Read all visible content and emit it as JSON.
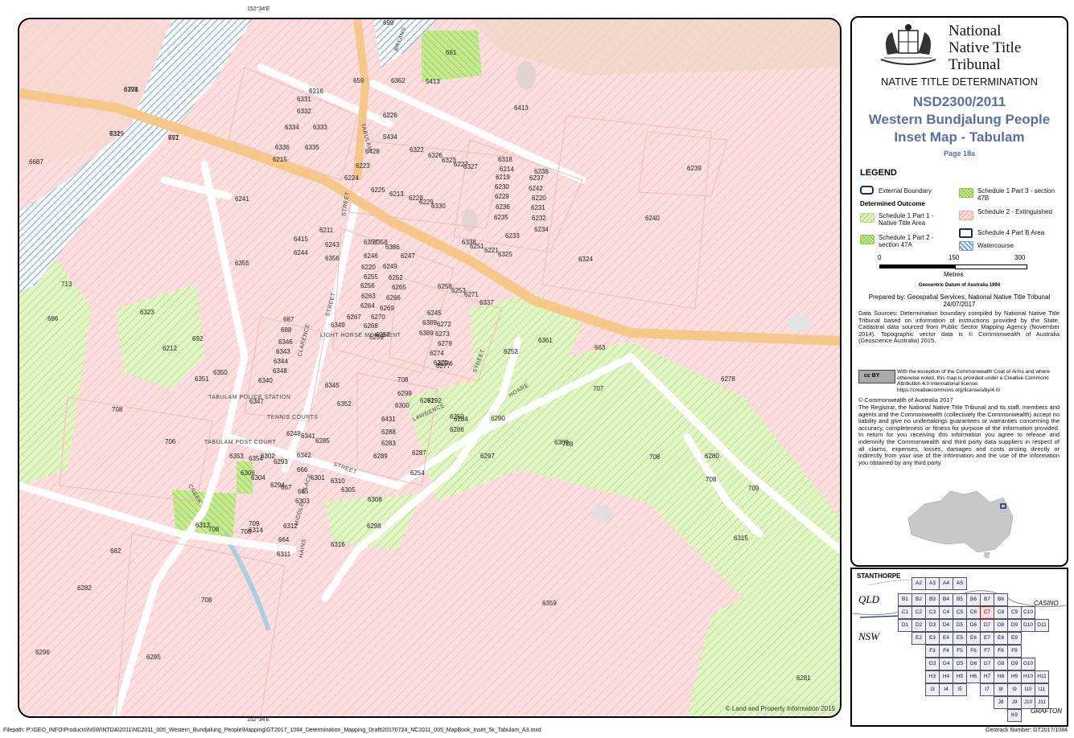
{
  "map": {
    "coord_top": "152°34'E",
    "coord_bottom": "152°34'E",
    "copyright": "© Land and Property Information 2015",
    "parcels": [
      "6778",
      "732",
      "757",
      "6687",
      "713",
      "686",
      "6216",
      "6331",
      "6332",
      "6334",
      "6333",
      "6336",
      "6335",
      "6215",
      "659",
      "6362",
      "699",
      "661",
      "5413",
      "6413",
      "6226",
      "5434",
      "6322",
      "6326",
      "6323",
      "6227",
      "6327",
      "6428",
      "6223",
      "6224",
      "6225",
      "6213",
      "6228",
      "6229",
      "6330",
      "6318",
      "6214",
      "6219",
      "6230",
      "6229",
      "6236",
      "6235",
      "6238",
      "6237",
      "6242",
      "6220",
      "6231",
      "6232",
      "6234",
      "6233",
      "6239",
      "6240",
      "6241",
      "6211",
      "6415",
      "6243",
      "6244",
      "6356",
      "6355",
      "6357",
      "6358",
      "6386",
      "6247",
      "6246",
      "6220",
      "6249",
      "6255",
      "6252",
      "6256",
      "6265",
      "6263",
      "6266",
      "6264",
      "6269",
      "6267",
      "6270",
      "6268",
      "6257",
      "6259",
      "6258",
      "6253",
      "6271",
      "6337",
      "6338",
      "6251",
      "6221",
      "6325",
      "6324",
      "6323",
      "6212",
      "692",
      "687",
      "688",
      "6346",
      "6343",
      "6344",
      "6348",
      "6349",
      "6350",
      "6351",
      "6340",
      "6347",
      "6345",
      "6352",
      "6245",
      "6389",
      "6389",
      "6272",
      "6273",
      "6279",
      "6274",
      "6275",
      "6276",
      "6277",
      "6278",
      "6252",
      "6361",
      "707",
      "663",
      "708",
      "706",
      "708",
      "6299",
      "6300",
      "6431",
      "6288",
      "6283",
      "6289",
      "6291",
      "6292",
      "6250",
      "6286",
      "6287",
      "6254",
      "6284",
      "6290",
      "6248",
      "6341",
      "6285",
      "6342",
      "6353",
      "6354",
      "6302",
      "6293",
      "666",
      "6301",
      "6310",
      "6306",
      "6304",
      "6294",
      "667",
      "665",
      "6303",
      "6305",
      "6309",
      "6297",
      "6308",
      "708",
      "708",
      "6280",
      "708",
      "709",
      "709",
      "708",
      "708",
      "6313",
      "6314",
      "6312",
      "664",
      "6311",
      "6298",
      "6316",
      "6315",
      "662",
      "6282",
      "708",
      "6359",
      "6296",
      "6295",
      "6281",
      "6391",
      "6319",
      "671"
    ],
    "streets": [
      "BRYANS",
      "TABULAM",
      "STREET",
      "CLARENCE",
      "STREET",
      "HOARE",
      "STREET",
      "LAWRENCE",
      "STREET",
      "TABULAM POST COURT",
      "CREEK",
      "HAINS",
      "MIDDLE",
      "PLACE",
      "LIGHT HORSE MONUMENT",
      "TABULAM POLICE STATION",
      "TENNIS COURTS"
    ]
  },
  "panel": {
    "org_line1": "National",
    "org_line2": "Native Title",
    "org_line3": "Tribunal",
    "determination": "NATIVE TITLE DETERMINATION",
    "case_number": "NSD2300/2011",
    "case_name": "Western Bundjalung People",
    "map_name": "Inset Map - Tabulam",
    "page_ref": "Page 18a",
    "legend_title": "LEGEND",
    "legend": {
      "external_boundary": "External Boundary",
      "determined_outcome": "Determined Outcome",
      "sch1p1": "Schedule 1 Part 1 - Native Title Area",
      "sch1p2": "Schedule 1 Part 2 - section 47A",
      "sch1p3": "Schedule 1 Part 3 - section 47B",
      "sch2": "Schedule 2 - Extinguished",
      "sch4b": "Schedule 4 Part B Area",
      "watercourse": "Watercourse"
    },
    "scale": {
      "s0": "0",
      "s1": "150",
      "s2": "300",
      "unit": "Metres"
    },
    "datum": "Geocentric Datum of Australia 1994",
    "prepared": "Prepared by: Geospatial Services, National Native Title Tribunal 24/07/2017",
    "data_sources": "Data Sources: Determination boundary compiled by National Native Title Tribunal based on information of instructions provided by the State. Cadastral data sourced from Public Sector Mapping Agency (November 2014). Topographic vector data is © Commonwealth of Australia (Geoscience Australia) 2015.",
    "cc_text": "With the exception of the Commonwealth Coat of Arms and where otherwise noted, this map is provided under a Creative Commons Attribution 4.0 International license: https://creativecommons.org/licenses/by/4.0/",
    "cc_badge": "cc BY",
    "copyright": "© Commonwealth of Australia 2017",
    "disclaimer": "The Registrar, the National Native Title Tribunal and its staff, members and agents and the Commonwealth (collectively the Commonwealth) accept no liability and give no undertakings guarantees or warranties concerning the accuracy, completeness or fitness for purpose of the information provided. In return for you receiving this information you agree to release and indemnify the Commonwealth and third party data suppliers in respect of all claims, expenses, losses, damages and costs arising directly or indirectly from your use of the information and the use of the information you obtained by any third party."
  },
  "index_map": {
    "places": {
      "stanthorpe": "STANTHORPE",
      "casino": "CASINO",
      "grafton": "GRAFTON",
      "qld": "QLD",
      "nsw": "NSW"
    },
    "cells": [
      "A2",
      "A3",
      "A4",
      "A5",
      "B1",
      "B2",
      "B3",
      "B4",
      "B5",
      "B6",
      "B7",
      "B8",
      "C1",
      "C2",
      "C3",
      "C4",
      "C5",
      "C6",
      "C7",
      "C8",
      "C9",
      "C10",
      "D1",
      "D2",
      "D3",
      "D4",
      "D5",
      "D6",
      "D7",
      "D8",
      "D9",
      "D10",
      "D11",
      "E2",
      "E3",
      "E4",
      "E5",
      "E6",
      "E7",
      "E8",
      "E9",
      "F3",
      "F4",
      "F5",
      "F6",
      "F7",
      "F8",
      "F9",
      "G3",
      "G4",
      "G5",
      "G6",
      "G7",
      "G8",
      "G9",
      "G10",
      "H3",
      "H4",
      "H5",
      "H6",
      "H7",
      "H8",
      "H9",
      "H10",
      "H11",
      "I3",
      "I4",
      "I5",
      "I7",
      "I8",
      "I9",
      "I10",
      "I11",
      "J8",
      "J9",
      "J10",
      "J11",
      "K9"
    ]
  },
  "footer": {
    "filepath": "Filepath: P:\\GEO_INFO\\Products\\NSW\\NTDA\\2011\\NC2011_005_Western_Bundjalung_People\\Mapping\\GT2017_1084_Determination_Mapping_Draft\\20170724_NC2011_005_MapBook_Inset_5k_Tabulam_A3.mxd",
    "geotrack": "Geotrack Number: GT2017/1084"
  }
}
